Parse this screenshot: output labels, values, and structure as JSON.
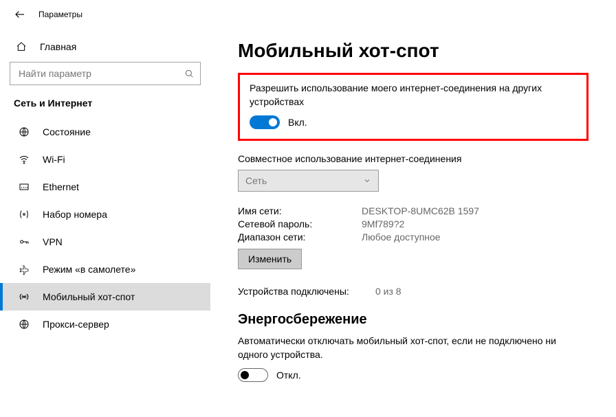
{
  "titlebar": {
    "title": "Параметры"
  },
  "sidebar": {
    "home": "Главная",
    "search_placeholder": "Найти параметр",
    "category": "Сеть и Интернет",
    "items": [
      {
        "label": "Состояние"
      },
      {
        "label": "Wi-Fi"
      },
      {
        "label": "Ethernet"
      },
      {
        "label": "Набор номера"
      },
      {
        "label": "VPN"
      },
      {
        "label": "Режим «в самолете»"
      },
      {
        "label": "Мобильный хот-спот"
      },
      {
        "label": "Прокси-сервер"
      }
    ],
    "active_index": 6
  },
  "main": {
    "title": "Мобильный хот-спот",
    "share_desc": "Разрешить использование моего интернет-соединения на других устройствах",
    "share_state": "Вкл.",
    "sharing_label": "Совместное использование интернет-соединения",
    "sharing_dropdown": "Сеть",
    "kv": {
      "name_label": "Имя сети:",
      "name_value": "DESKTOP-8UMC62B 1597",
      "pass_label": "Сетевой пароль:",
      "pass_value": "9Mf789?2",
      "band_label": "Диапазон сети:",
      "band_value": "Любое доступное"
    },
    "edit_button": "Изменить",
    "devices_label": "Устройства подключены:",
    "devices_value": "0 из 8",
    "power_title": "Энергосбережение",
    "power_desc": "Автоматически отключать мобильный хот-спот, если не подключено ни одного устройства.",
    "power_state": "Откл."
  }
}
